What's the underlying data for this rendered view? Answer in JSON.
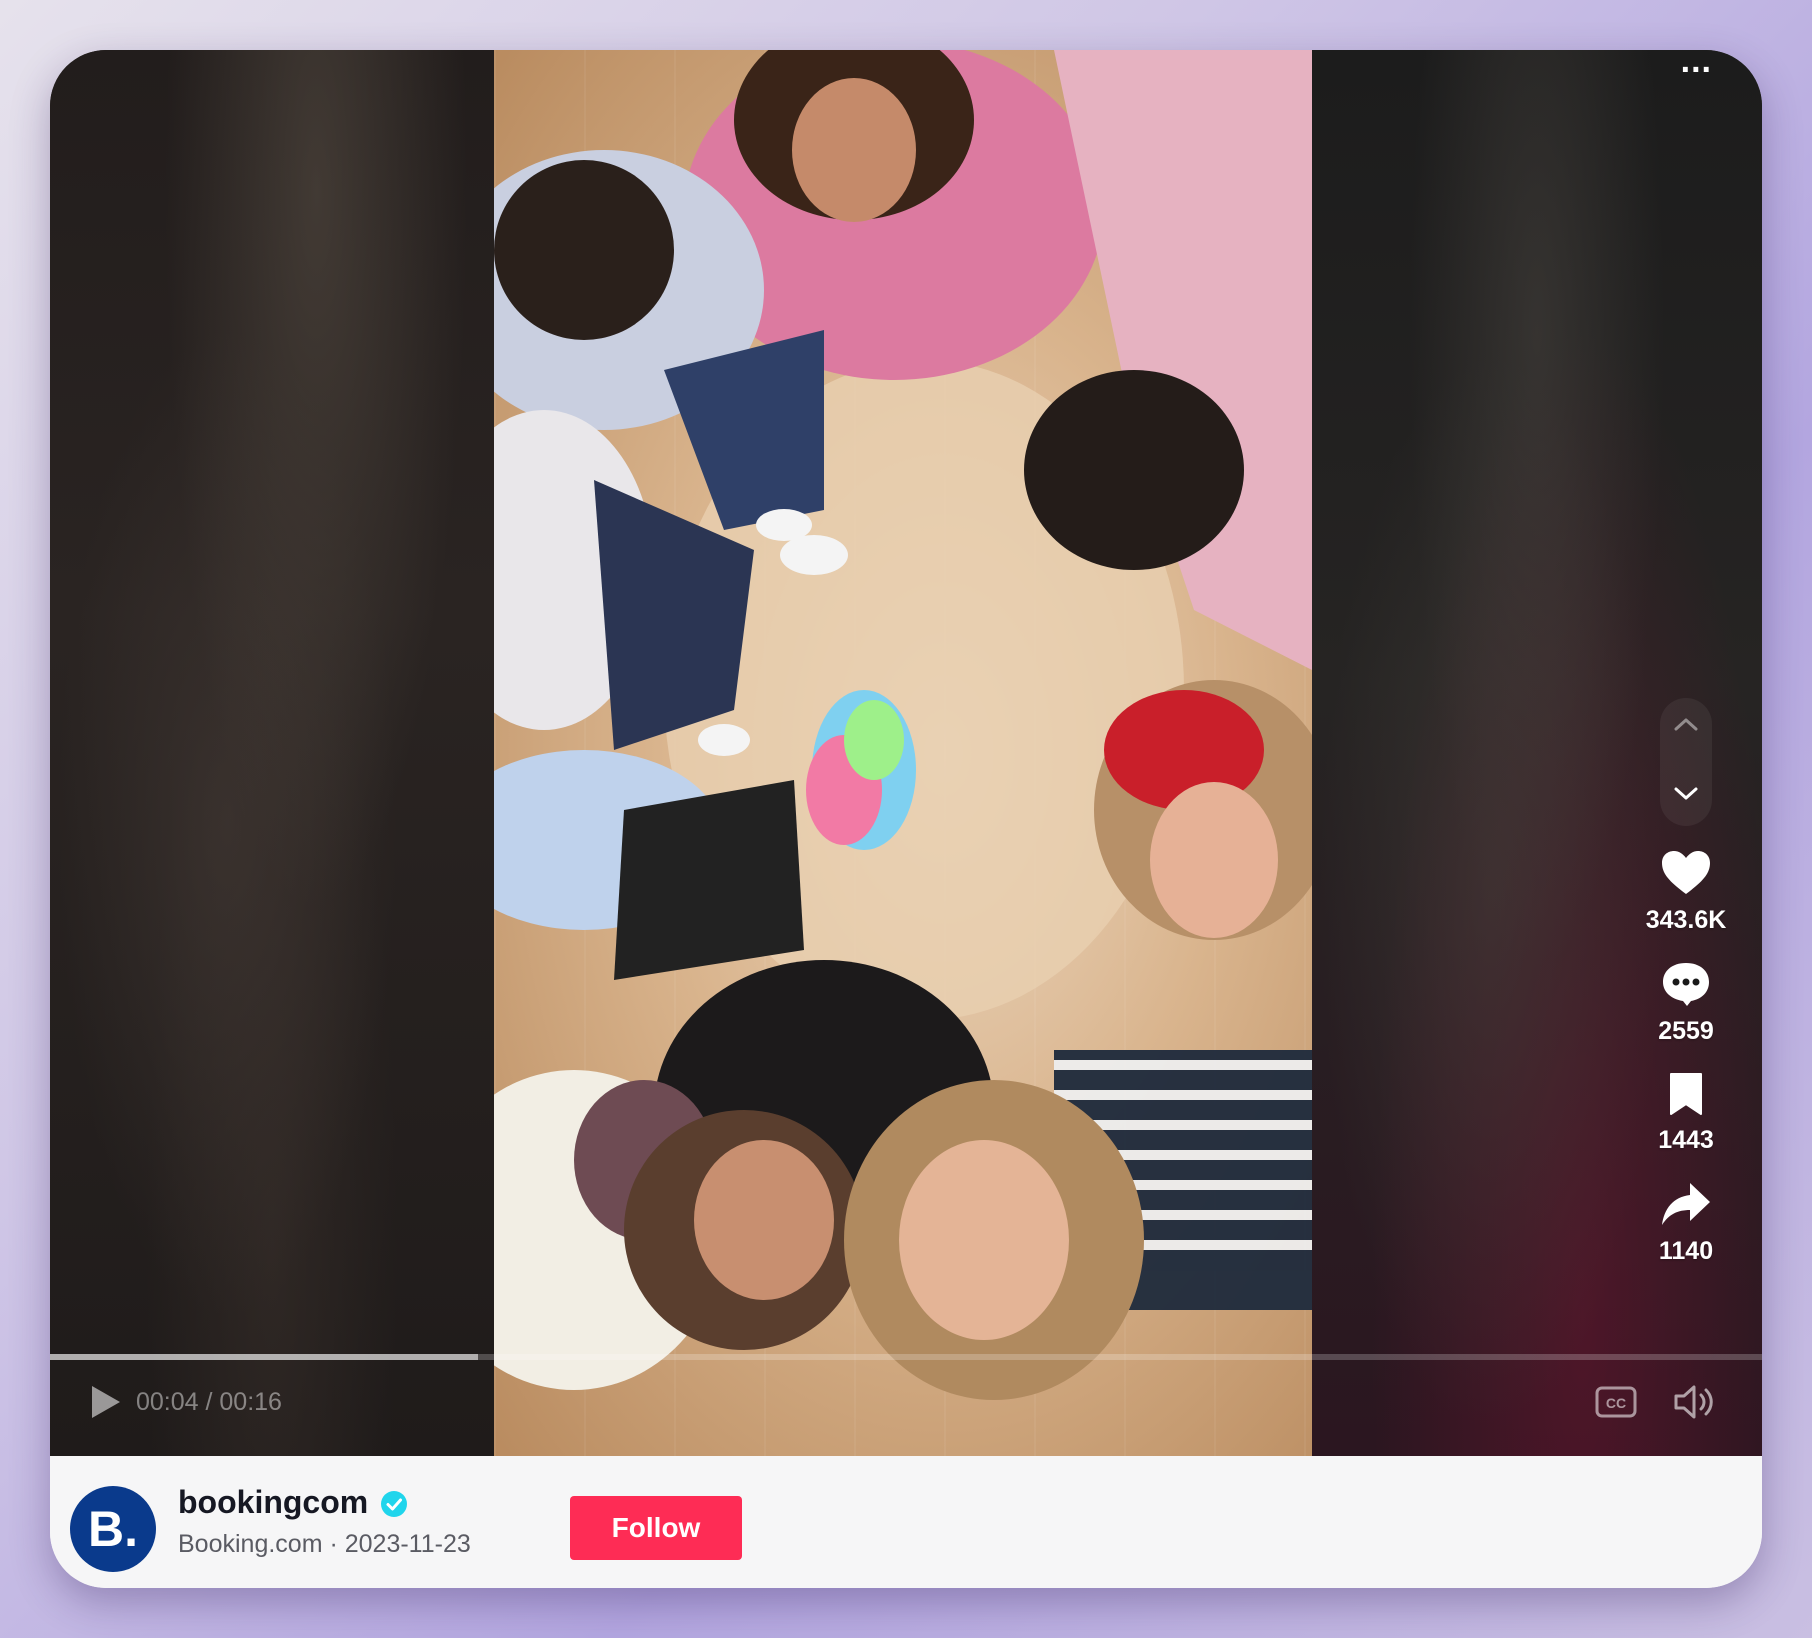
{
  "player": {
    "more_label": "...",
    "time_current": "00:04",
    "time_total": "00:16",
    "time_display": "00:04 / 00:16",
    "progress_fraction": 0.25
  },
  "actions": {
    "likes": "343.6K",
    "comments": "2559",
    "saves": "1443",
    "shares": "1140"
  },
  "footer": {
    "avatar_letter": "B.",
    "username": "bookingcom",
    "display_name": "Booking.com",
    "date": "2023-11-23",
    "meta": "Booking.com · 2023-11-23",
    "follow_label": "Follow"
  },
  "colors": {
    "follow_button": "#fe2c55",
    "avatar_bg": "#0a3a8c",
    "verified": "#20d5ec"
  }
}
